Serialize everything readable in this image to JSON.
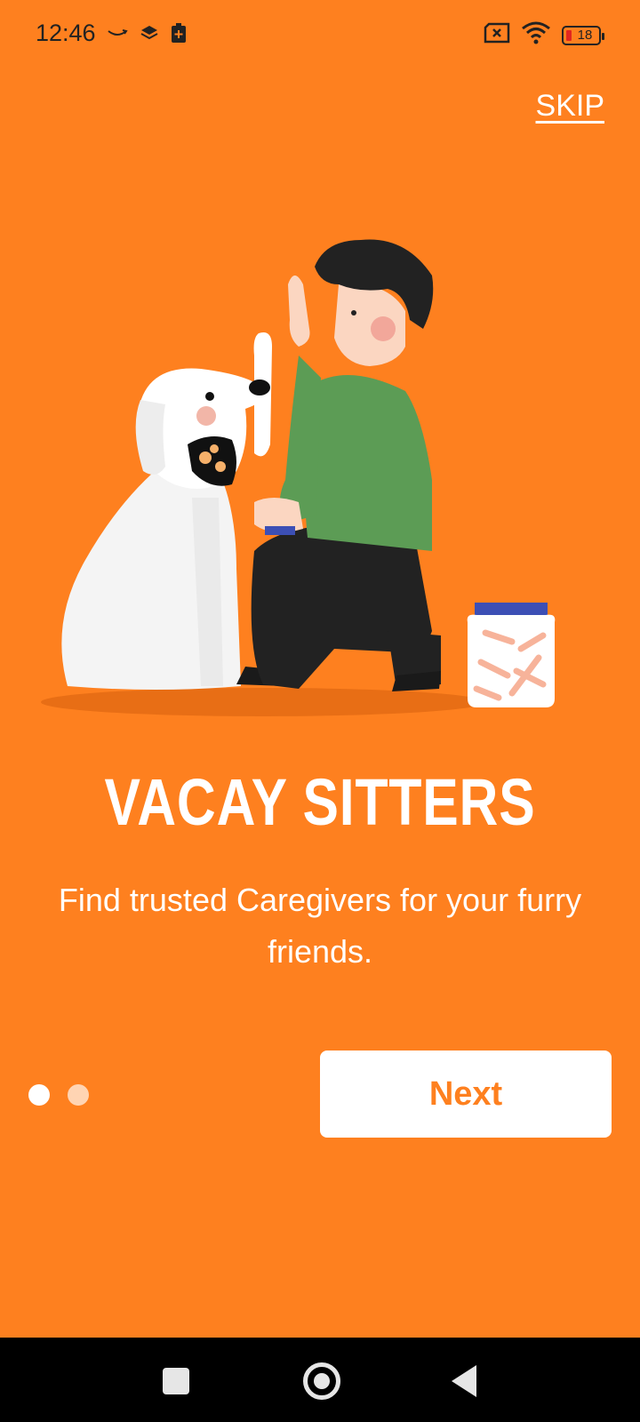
{
  "status_bar": {
    "time": "12:46",
    "battery_level": "18"
  },
  "header": {
    "skip_label": "SKIP"
  },
  "onboarding": {
    "title": "VACAY SITTERS",
    "subtitle": "Find trusted Caregivers for your furry friends.",
    "page_indicator": {
      "total": 2,
      "current": 1
    },
    "next_label": "Next"
  },
  "colors": {
    "background": "#FE801F",
    "button_bg": "#FFFFFF",
    "button_text": "#FE801F",
    "dot_active": "#FFFFFF",
    "dot_inactive": "#FFD4B3"
  },
  "icons": [
    "amazon-smile-icon",
    "layers-icon",
    "battery-plus-icon",
    "no-sim-icon",
    "wifi-icon",
    "battery-icon",
    "recent-apps-icon",
    "home-icon",
    "back-icon"
  ]
}
